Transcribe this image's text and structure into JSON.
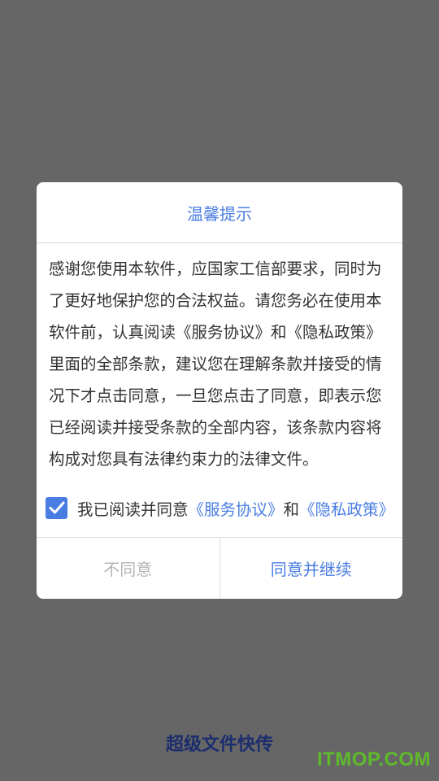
{
  "dialog": {
    "title": "温馨提示",
    "body": "感谢您使用本软件，应国家工信部要求，同时为了更好地保护您的合法权益。请您务必在使用本软件前，认真阅读《服务协议》和《隐私政策》里面的全部条款，建议您在理解条款并接受的情况下才点击同意，一旦您点击了同意，即表示您已经阅读并接受条款的全部内容，该条款内容将构成对您具有法律约束力的法律文件。",
    "agree": {
      "checked": true,
      "prefix": "我已阅读并同意",
      "service_link": "《服务协议》",
      "and": "和",
      "privacy_link": "《隐私政策》"
    },
    "disagree_label": "不同意",
    "accept_label": "同意并继续"
  },
  "app_name": "超级文件快传",
  "watermark": "ITMOP.COM",
  "colors": {
    "overlay": "#666666",
    "accent": "#4a7de2",
    "app_name": "#1c2d6e",
    "watermark": "#5fbf28"
  }
}
